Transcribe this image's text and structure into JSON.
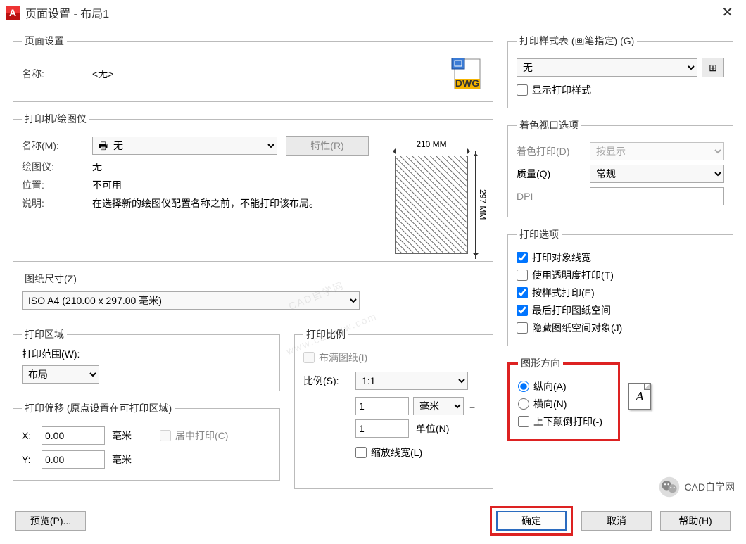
{
  "title": "页面设置 - 布局1",
  "page_setup": {
    "legend": "页面设置",
    "name_label": "名称:",
    "name_value": "<无>"
  },
  "printer": {
    "legend": "打印机/绘图仪",
    "name_label": "名称(M):",
    "name_value": "无",
    "properties_btn": "特性(R)",
    "plotter_label": "绘图仪:",
    "plotter_value": "无",
    "location_label": "位置:",
    "location_value": "不可用",
    "desc_label": "说明:",
    "desc_value": "在选择新的绘图仪配置名称之前，不能打印该布局。",
    "paper_w": "210 MM",
    "paper_h": "297 MM"
  },
  "paper_size": {
    "legend": "图纸尺寸(Z)",
    "value": "ISO A4 (210.00 x 297.00 毫米)"
  },
  "print_area": {
    "legend": "打印区域",
    "range_label": "打印范围(W):",
    "range_value": "布局"
  },
  "print_scale": {
    "legend": "打印比例",
    "fit": "布满图纸(I)",
    "scale_label": "比例(S):",
    "scale_value": "1:1",
    "unit1_value": "1",
    "unit1_unit": "毫米",
    "equals": "=",
    "unit2_value": "1",
    "unit2_label": "单位(N)",
    "scale_lw": "缩放线宽(L)"
  },
  "offset": {
    "legend": "打印偏移 (原点设置在可打印区域)",
    "x_label": "X:",
    "x_value": "0.00",
    "y_label": "Y:",
    "y_value": "0.00",
    "unit": "毫米",
    "center": "居中打印(C)"
  },
  "plot_style": {
    "legend": "打印样式表 (画笔指定) (G)",
    "value": "无",
    "show": "显示打印样式"
  },
  "shade": {
    "legend": "着色视口选项",
    "shade_label": "着色打印(D)",
    "shade_value": "按显示",
    "quality_label": "质量(Q)",
    "quality_value": "常规",
    "dpi_label": "DPI"
  },
  "options": {
    "legend": "打印选项",
    "lw": "打印对象线宽",
    "trans": "使用透明度打印(T)",
    "style": "按样式打印(E)",
    "last": "最后打印图纸空间",
    "hide": "隐藏图纸空间对象(J)"
  },
  "orientation": {
    "legend": "图形方向",
    "portrait": "纵向(A)",
    "landscape": "横向(N)",
    "upside": "上下颠倒打印(-)"
  },
  "buttons": {
    "preview": "预览(P)...",
    "ok": "确定",
    "cancel": "取消",
    "help": "帮助(H)"
  },
  "watermark": {
    "line1": "CAD自学网",
    "line2": "www.cadzxw.com"
  },
  "badge": "CAD自学网"
}
